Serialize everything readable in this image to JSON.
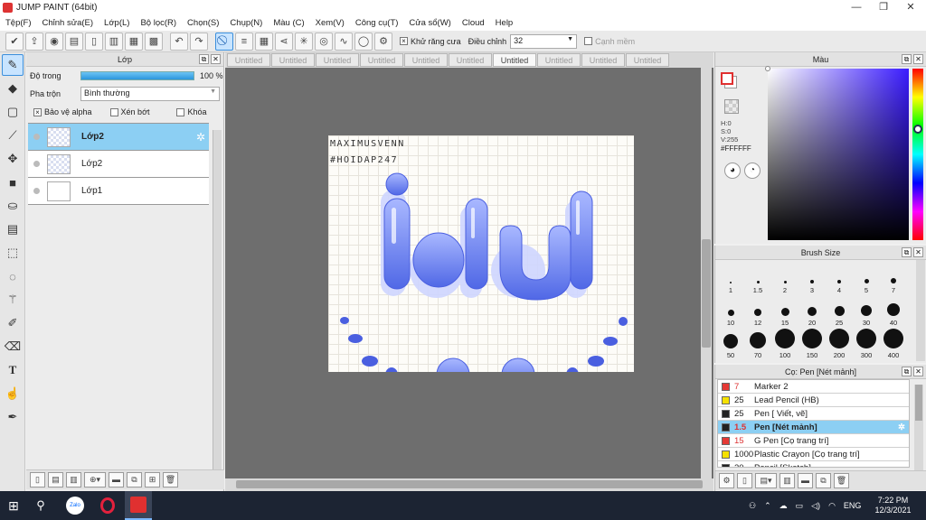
{
  "window": {
    "title": "JUMP PAINT (64bit)",
    "min": "—",
    "max": "❐",
    "close": "✕"
  },
  "menu": [
    "Tệp(F)",
    "Chỉnh sửa(E)",
    "Lớp(L)",
    "Bộ lọc(R)",
    "Chọn(S)",
    "Chụp(N)",
    "Màu (C)",
    "Xem(V)",
    "Công cụ(T)",
    "Cửa sổ(W)",
    "Cloud",
    "Help"
  ],
  "toolbar": {
    "antialias_label": "Khử răng cưa",
    "adjust_label": "Điều chỉnh",
    "adjust_value": "32",
    "smooth_label": "Cạnh mềm"
  },
  "layers_panel": {
    "title": "Lớp",
    "opacity_label": "Độ trong",
    "opacity_value": "100 %",
    "opacity_fraction": 1.0,
    "blend_label": "Pha trộn",
    "blend_value": "Bình thường",
    "protect_alpha": "Bảo vệ alpha",
    "clip": "Xén bớt",
    "lock": "Khóa",
    "layers": [
      {
        "name": "Lớp2",
        "selected": true
      },
      {
        "name": "Lớp2",
        "selected": false
      },
      {
        "name": "Lớp1",
        "selected": false
      }
    ]
  },
  "doc_tabs": [
    "Untitled",
    "Untitled",
    "Untitled",
    "Untitled",
    "Untitled",
    "Untitled",
    "Untitled",
    "Untitled",
    "Untitled",
    "Untitled"
  ],
  "active_tab_index": 6,
  "canvas": {
    "line1": "MAXIMUSVENN",
    "line2": "#HOIDAP247",
    "word": "Idul",
    "accent": "#6c82f0"
  },
  "color_panel": {
    "title": "Màu",
    "h": "H:0",
    "s": "S:0",
    "v": "V:255",
    "hex": "#FFFFFF",
    "current": "#ffffff",
    "secondary_outline": "#e03030"
  },
  "brush_panel": {
    "title": "Brush Size",
    "sizes": [
      "1",
      "1.5",
      "2",
      "3",
      "4",
      "5",
      "7",
      "10",
      "12",
      "15",
      "20",
      "25",
      "30",
      "40",
      "50",
      "70",
      "100",
      "150",
      "200",
      "300",
      "400"
    ]
  },
  "pen_panel": {
    "title": "Cọ: Pen [Nét mảnh]",
    "items": [
      {
        "size": "7",
        "name": "Marker 2",
        "color": "#e53935",
        "selected": false
      },
      {
        "size": "25",
        "name": "Lead Pencil (HB)",
        "color": "#f5e100",
        "selected": false
      },
      {
        "size": "25",
        "name": "Pen [ Viết, vẽ]",
        "color": "#222222",
        "selected": false
      },
      {
        "size": "1.5",
        "name": "Pen [Nét mảnh]",
        "color": "#222222",
        "selected": true
      },
      {
        "size": "15",
        "name": "G Pen [Cọ trang trí]",
        "color": "#e53935",
        "selected": false
      },
      {
        "size": "1000",
        "name": "Plastic Crayon [Cọ trang trí]",
        "color": "#f5e100",
        "selected": false
      },
      {
        "size": "20",
        "name": "Pencil [Sketch]",
        "color": "#222222",
        "selected": false
      }
    ]
  },
  "taskbar": {
    "lang": "ENG",
    "time": "7:22 PM",
    "date": "12/3/2021",
    "zalo": "Zalo"
  }
}
